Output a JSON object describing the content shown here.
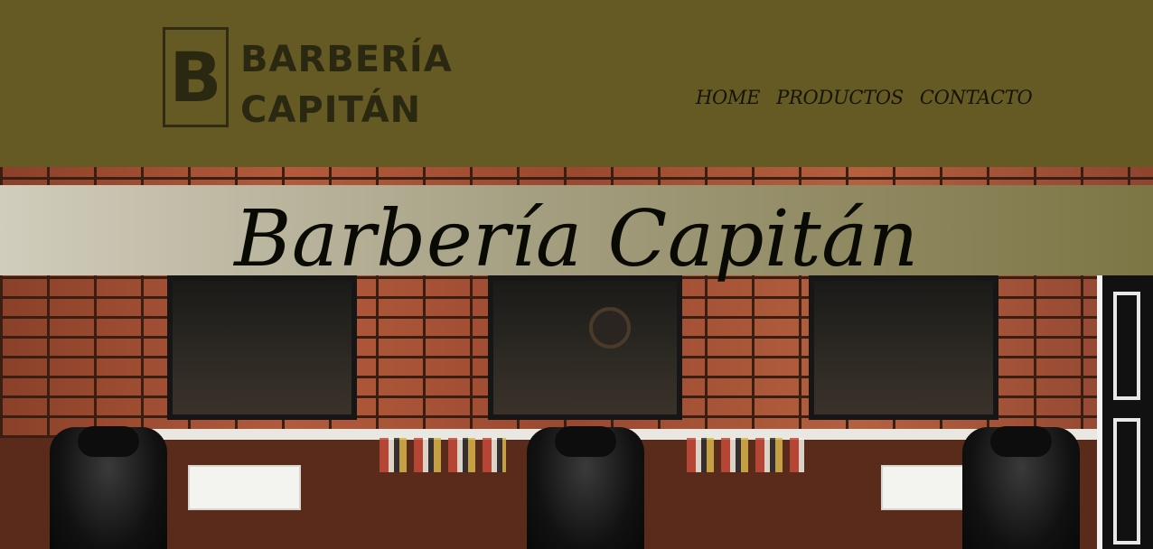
{
  "header": {
    "logo": {
      "letter": "B",
      "line1": "BARBERÍA",
      "line2": "CAPITÁN"
    },
    "nav": [
      {
        "label": "HOME"
      },
      {
        "label": "PRODUCTOS"
      },
      {
        "label": "CONTACTO"
      }
    ]
  },
  "hero": {
    "title": "Barbería Capitán",
    "image_icon": "barbershop-photo"
  },
  "colors": {
    "header_bg": "#655a24",
    "band_gradient_start": "#d1cdbc",
    "band_gradient_end": "#7c7544",
    "text_dark": "#141409"
  }
}
